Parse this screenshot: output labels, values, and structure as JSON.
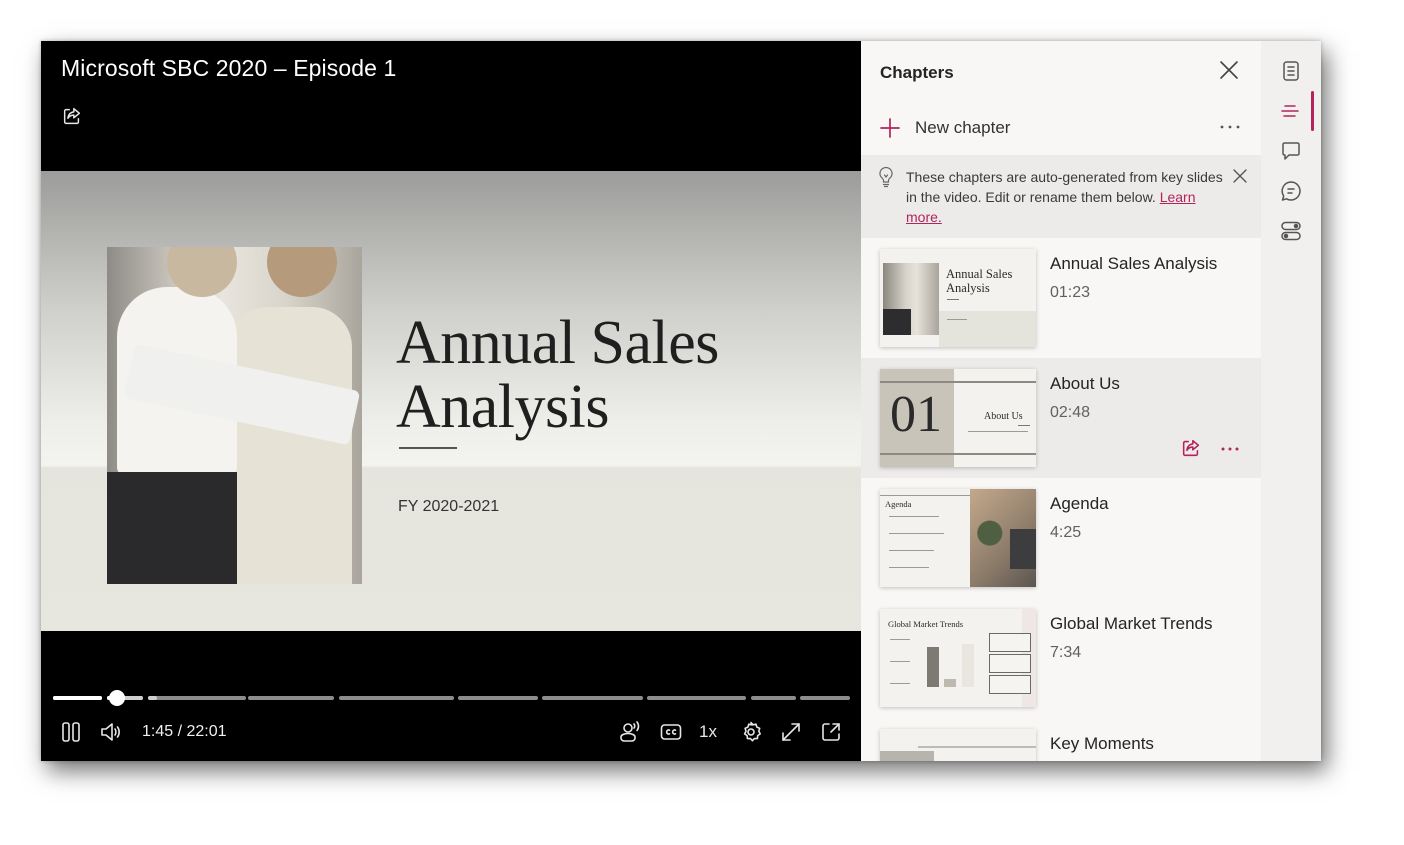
{
  "player": {
    "title": "Microsoft SBC 2020 – Episode 1",
    "share_icon": "share-icon",
    "slide": {
      "title_line1": "Annual Sales",
      "title_line2": "Analysis",
      "subtitle": "FY 2020-2021"
    },
    "progress": {
      "current_time": "1:45",
      "duration": "22:01",
      "played_fraction": 0.08,
      "buffered_fraction": 0.13,
      "chapter_segments": 10
    },
    "time_display": "1:45 / 22:01",
    "controls": {
      "pause_icon": "pause-icon",
      "volume_icon": "volume-icon",
      "speaker_view_icon": "speaker-icon",
      "captions_icon": "closed-captions-icon",
      "speed_label": "1x",
      "settings_icon": "gear-icon",
      "fullscreen_icon": "expand-icon",
      "popout_icon": "open-in-new-window-icon"
    }
  },
  "chapters_panel": {
    "title": "Chapters",
    "new_chapter_label": "New chapter",
    "info": {
      "text": "These chapters are auto-generated from key slides in the video. Edit or rename them below.",
      "link": "Learn more."
    },
    "chapters": [
      {
        "title": "Annual Sales Analysis",
        "time": "01:23",
        "thumb_title": "Annual Sales Analysis",
        "active": false
      },
      {
        "title": "About Us",
        "time": "02:48",
        "thumb_number": "01",
        "thumb_title": "About Us",
        "active": true
      },
      {
        "title": "Agenda",
        "time": "4:25",
        "thumb_title": "Agenda",
        "active": false
      },
      {
        "title": "Global Market Trends",
        "time": "7:34",
        "thumb_title": "Global Market Trends",
        "active": false
      },
      {
        "title": "Key Moments",
        "time": "",
        "active": false
      }
    ]
  },
  "rail": {
    "items": [
      "transcript-icon",
      "chapters-icon",
      "comments-icon",
      "chat-icon",
      "toggles-icon"
    ],
    "active_index": 1
  },
  "colors": {
    "accent": "#b3245c",
    "player_bg": "#000000",
    "panel_bg": "#f8f7f5",
    "info_bg": "#ecebe9"
  }
}
